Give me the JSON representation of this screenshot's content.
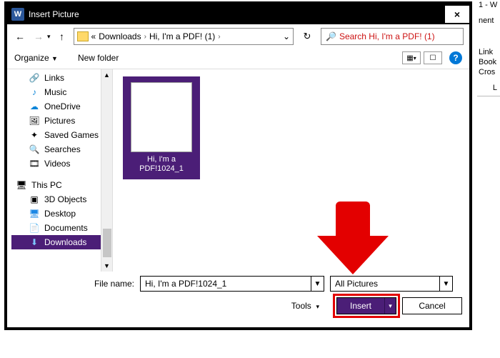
{
  "obscured_panel": {
    "line1": "1 - W",
    "line2": "nent",
    "line3": "  Link",
    "line4": "  Book",
    "line5": "  Cros",
    "line6": "L"
  },
  "dialog": {
    "title": "Insert Picture",
    "close_glyph": "×"
  },
  "nav": {
    "back_glyph": "←",
    "fwd_glyph": "→",
    "up_glyph": "↑",
    "breadcrumb_prefix": "«",
    "crumb1": "Downloads",
    "crumb2": "Hi, I'm a PDF! (1)",
    "sep": "›",
    "path_dd": "⌄",
    "refresh_glyph": "↻",
    "search_icon": "🔍",
    "search_placeholder": "Search Hi, I'm a PDF! (1)"
  },
  "toolbar": {
    "organize": "Organize",
    "newfolder": "New folder",
    "view1": "▦",
    "view2": "☐",
    "help": "?"
  },
  "tree": {
    "items": [
      {
        "icon": "🔗",
        "label": "Links"
      },
      {
        "icon": "♪",
        "label": "Music",
        "iconColor": "#0a84d8"
      },
      {
        "icon": "☁",
        "label": "OneDrive",
        "iconColor": "#0a84d8"
      },
      {
        "icon": "🖼",
        "label": "Pictures"
      },
      {
        "icon": "✦",
        "label": "Saved Games"
      },
      {
        "icon": "🔍",
        "label": "Searches"
      },
      {
        "icon": "🎞",
        "label": "Videos"
      }
    ],
    "pc_icon": "🖥",
    "pc_label": "This PC",
    "pc_items": [
      {
        "icon": "▣",
        "label": "3D Objects"
      },
      {
        "icon": "🖥",
        "label": "Desktop",
        "iconColor": "#1e88e5"
      },
      {
        "icon": "📄",
        "label": "Documents"
      },
      {
        "icon": "⬇",
        "label": "Downloads",
        "selected": true,
        "iconColor": "#7ec6ff"
      }
    ],
    "sb_up": "▲",
    "sb_down": "▼"
  },
  "filepane": {
    "selected_thumb_label": "Hi, I'm a PDF!1024_1"
  },
  "bottom": {
    "filename_label": "File name:",
    "filename_value": "Hi, I'm a PDF!1024_1",
    "filter_value": "All Pictures",
    "tools_label": "Tools",
    "insert_label": "Insert",
    "cancel_label": "Cancel",
    "dd_glyph": "▾",
    "dd_small": "▼"
  }
}
